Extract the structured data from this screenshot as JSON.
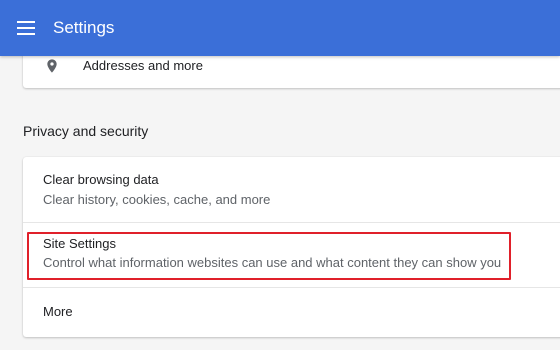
{
  "header": {
    "title": "Settings",
    "menu_icon": "hamburger-menu-icon",
    "background": "#3b6fd8"
  },
  "autofill": {
    "addresses_label": "Addresses and more",
    "icon": "location-pin-icon"
  },
  "privacy": {
    "heading": "Privacy and security",
    "items": [
      {
        "title": "Clear browsing data",
        "subtitle": "Clear history, cookies, cache, and more"
      },
      {
        "title": "Site Settings",
        "subtitle": "Control what information websites can use and what content they can show you",
        "highlighted": true
      },
      {
        "title": "More"
      }
    ]
  },
  "highlight_color": "#e0202a"
}
